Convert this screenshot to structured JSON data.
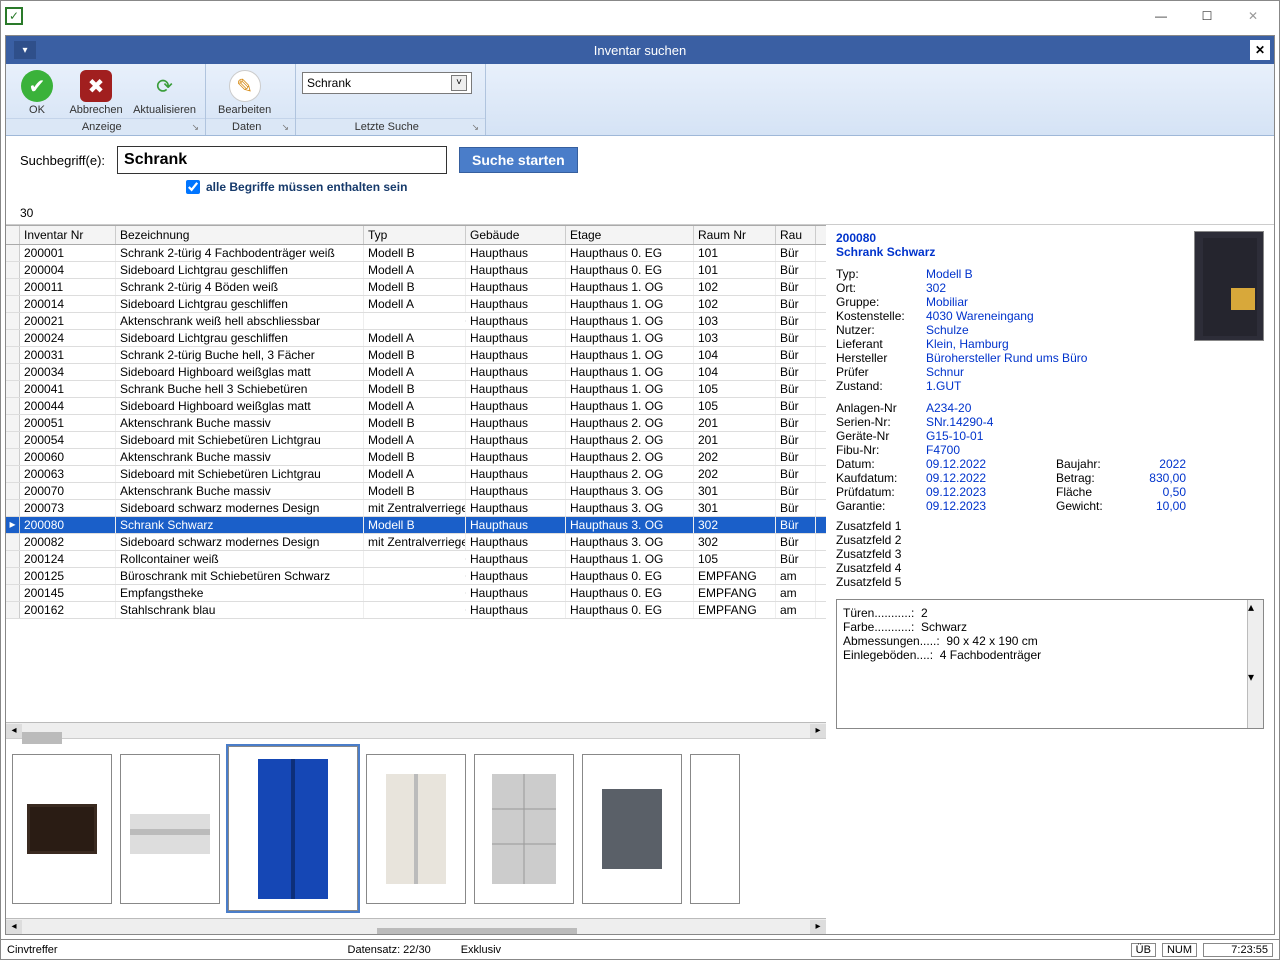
{
  "window": {
    "title_icon": "✓"
  },
  "title_btns": {
    "min": "—",
    "max": "☐",
    "close": "✕"
  },
  "subheader": {
    "title": "Inventar suchen"
  },
  "ribbon": {
    "ok": "OK",
    "cancel": "Abbrechen",
    "refresh": "Aktualisieren",
    "edit": "Bearbeiten",
    "grp_anzeige": "Anzeige",
    "grp_daten": "Daten",
    "grp_letzte": "Letzte Suche",
    "combo_value": "Schrank"
  },
  "search": {
    "label": "Suchbegriff(e):",
    "value": "Schrank",
    "button": "Suche starten",
    "check_label": "alle Begriffe müssen enthalten sein",
    "checked": true
  },
  "count": "30",
  "columns": {
    "inv": "Inventar Nr",
    "bez": "Bezeichnung",
    "typ": "Typ",
    "geb": "Gebäude",
    "etg": "Etage",
    "rnum": "Raum Nr",
    "rest": "Rau"
  },
  "rows": [
    {
      "sel": false,
      "inv": "200001",
      "bez": "Schrank 2-türig 4 Fachbodenträger weiß",
      "typ": "Modell B",
      "geb": "Haupthaus",
      "etg": "Haupthaus 0. EG",
      "rnum": "101",
      "rest": "Bür"
    },
    {
      "sel": false,
      "inv": "200004",
      "bez": "Sideboard Lichtgrau geschliffen",
      "typ": "Modell A",
      "geb": "Haupthaus",
      "etg": "Haupthaus 0. EG",
      "rnum": "101",
      "rest": "Bür"
    },
    {
      "sel": false,
      "inv": "200011",
      "bez": "Schrank 2-türig 4 Böden weiß",
      "typ": "Modell B",
      "geb": "Haupthaus",
      "etg": "Haupthaus 1. OG",
      "rnum": "102",
      "rest": "Bür"
    },
    {
      "sel": false,
      "inv": "200014",
      "bez": "Sideboard Lichtgrau geschliffen",
      "typ": "Modell A",
      "geb": "Haupthaus",
      "etg": "Haupthaus 1. OG",
      "rnum": "102",
      "rest": "Bür"
    },
    {
      "sel": false,
      "inv": "200021",
      "bez": "Aktenschrank weiß hell abschliessbar",
      "typ": "",
      "geb": "Haupthaus",
      "etg": "Haupthaus 1. OG",
      "rnum": "103",
      "rest": "Bür"
    },
    {
      "sel": false,
      "inv": "200024",
      "bez": "Sideboard Lichtgrau geschliffen",
      "typ": "Modell A",
      "geb": "Haupthaus",
      "etg": "Haupthaus 1. OG",
      "rnum": "103",
      "rest": "Bür"
    },
    {
      "sel": false,
      "inv": "200031",
      "bez": "Schrank  2-türig Buche hell, 3 Fächer",
      "typ": "Modell B",
      "geb": "Haupthaus",
      "etg": "Haupthaus 1. OG",
      "rnum": "104",
      "rest": "Bür"
    },
    {
      "sel": false,
      "inv": "200034",
      "bez": "Sideboard Highboard weißglas matt",
      "typ": "Modell A",
      "geb": "Haupthaus",
      "etg": "Haupthaus 1. OG",
      "rnum": "104",
      "rest": "Bür"
    },
    {
      "sel": false,
      "inv": "200041",
      "bez": "Schrank Buche hell 3 Schiebetüren",
      "typ": "Modell B",
      "geb": "Haupthaus",
      "etg": "Haupthaus 1. OG",
      "rnum": "105",
      "rest": "Bür"
    },
    {
      "sel": false,
      "inv": "200044",
      "bez": "Sideboard Highboard weißglas matt",
      "typ": "Modell A",
      "geb": "Haupthaus",
      "etg": "Haupthaus 1. OG",
      "rnum": "105",
      "rest": "Bür"
    },
    {
      "sel": false,
      "inv": "200051",
      "bez": "Aktenschrank Buche massiv",
      "typ": "Modell B",
      "geb": "Haupthaus",
      "etg": "Haupthaus 2. OG",
      "rnum": "201",
      "rest": "Bür"
    },
    {
      "sel": false,
      "inv": "200054",
      "bez": "Sideboard mit Schiebetüren Lichtgrau",
      "typ": "Modell A",
      "geb": "Haupthaus",
      "etg": "Haupthaus 2. OG",
      "rnum": "201",
      "rest": "Bür"
    },
    {
      "sel": false,
      "inv": "200060",
      "bez": "Aktenschrank Buche massiv",
      "typ": "Modell B",
      "geb": "Haupthaus",
      "etg": "Haupthaus 2. OG",
      "rnum": "202",
      "rest": "Bür"
    },
    {
      "sel": false,
      "inv": "200063",
      "bez": "Sideboard mit Schiebetüren Lichtgrau",
      "typ": "Modell A",
      "geb": "Haupthaus",
      "etg": "Haupthaus 2. OG",
      "rnum": "202",
      "rest": "Bür"
    },
    {
      "sel": false,
      "inv": "200070",
      "bez": "Aktenschrank Buche massiv",
      "typ": "Modell B",
      "geb": "Haupthaus",
      "etg": "Haupthaus 3. OG",
      "rnum": "301",
      "rest": "Bür"
    },
    {
      "sel": false,
      "inv": "200073",
      "bez": "Sideboard schwarz modernes Design",
      "typ": "mit Zentralverriege",
      "geb": "Haupthaus",
      "etg": "Haupthaus 3. OG",
      "rnum": "301",
      "rest": "Bür"
    },
    {
      "sel": true,
      "inv": "200080",
      "bez": "Schrank Schwarz",
      "typ": "Modell B",
      "geb": "Haupthaus",
      "etg": "Haupthaus 3. OG",
      "rnum": "302",
      "rest": "Bür"
    },
    {
      "sel": false,
      "inv": "200082",
      "bez": "Sideboard schwarz modernes Design",
      "typ": "mit Zentralverriege",
      "geb": "Haupthaus",
      "etg": "Haupthaus 3. OG",
      "rnum": "302",
      "rest": "Bür"
    },
    {
      "sel": false,
      "inv": "200124",
      "bez": "Rollcontainer weiß",
      "typ": "",
      "geb": "Haupthaus",
      "etg": "Haupthaus 1. OG",
      "rnum": "105",
      "rest": "Bür"
    },
    {
      "sel": false,
      "inv": "200125",
      "bez": "Büroschrank mit Schiebetüren Schwarz",
      "typ": "",
      "geb": "Haupthaus",
      "etg": "Haupthaus 0. EG",
      "rnum": "EMPFANG",
      "rest": "am"
    },
    {
      "sel": false,
      "inv": "200145",
      "bez": "Empfangstheke",
      "typ": "",
      "geb": "Haupthaus",
      "etg": "Haupthaus 0. EG",
      "rnum": "EMPFANG",
      "rest": "am"
    },
    {
      "sel": false,
      "inv": "200162",
      "bez": "Stahlschrank blau",
      "typ": "",
      "geb": "Haupthaus",
      "etg": "Haupthaus 0. EG",
      "rnum": "EMPFANG",
      "rest": "am"
    }
  ],
  "detail": {
    "id": "200080",
    "name": "Schrank Schwarz",
    "fields_left": [
      {
        "l": "Typ:",
        "v": "Modell B"
      },
      {
        "l": "Ort:",
        "v": "302"
      },
      {
        "l": "Gruppe:",
        "v": "Mobiliar"
      },
      {
        "l": "Kostenstelle:",
        "v": "4030 Wareneingang"
      },
      {
        "l": "Nutzer:",
        "v": "Schulze"
      },
      {
        "l": "Lieferant",
        "v": "Klein, Hamburg"
      },
      {
        "l": "Hersteller",
        "v": "Bürohersteller Rund ums Büro"
      },
      {
        "l": "Prüfer",
        "v": "Schnur"
      },
      {
        "l": "Zustand:",
        "v": "1.GUT"
      }
    ],
    "fields_mid": [
      {
        "l": "Anlagen-Nr",
        "v": "A234-20"
      },
      {
        "l": "Serien-Nr:",
        "v": "SNr.14290-4"
      },
      {
        "l": "Geräte-Nr",
        "v": "G15-10-01"
      },
      {
        "l": "Fibu-Nr:",
        "v": "F4700"
      },
      {
        "l": "Datum:",
        "v": "09.12.2022"
      },
      {
        "l": "Kaufdatum:",
        "v": "09.12.2022"
      },
      {
        "l": "Prüfdatum:",
        "v": "09.12.2023"
      },
      {
        "l": "Garantie:",
        "v": "09.12.2023"
      }
    ],
    "fields_right": [
      {
        "l": "Baujahr:",
        "v": "2022"
      },
      {
        "l": "Betrag:",
        "v": "830,00"
      },
      {
        "l": "Fläche",
        "v": "0,50"
      },
      {
        "l": "Gewicht:",
        "v": "10,00"
      }
    ],
    "extras": [
      "Zusatzfeld 1",
      "Zusatzfeld 2",
      "Zusatzfeld 3",
      "Zusatzfeld 4",
      "Zusatzfeld 5"
    ],
    "notes": "Türen...........:  2\nFarbe...........:  Schwarz\nAbmessungen.....:  90 x 42 x 190 cm\nEinlegeböden....:  4 Fachbodenträger"
  },
  "status": {
    "left": "Cinvtreffer",
    "rec": "Datensatz: 22/30",
    "mode": "Exklusiv",
    "ub": "ÜB",
    "num": "NUM",
    "time": "7:23:55"
  }
}
